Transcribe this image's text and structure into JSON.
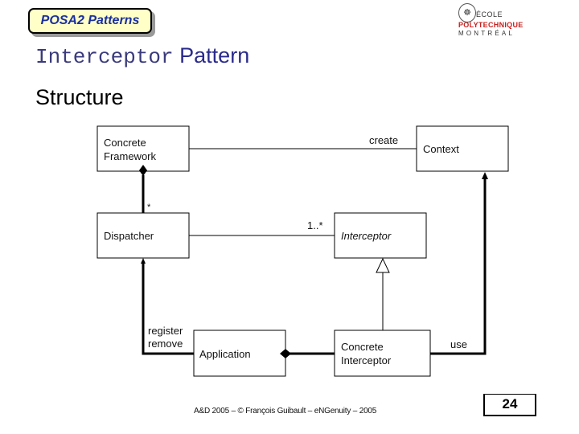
{
  "header": {
    "badge_label": "POSA2 Patterns",
    "logo": {
      "crest_icon": "university-crest-icon",
      "line1": "ÉCOLE",
      "line2": "POLYTECHNIQUE",
      "line3": "MONTRÉAL"
    }
  },
  "slide": {
    "title_mono": "Interceptor",
    "title_rest": "Pattern",
    "subtitle": "Structure"
  },
  "diagram": {
    "classes": {
      "concrete_framework": [
        "Concrete",
        "Framework"
      ],
      "context": "Context",
      "dispatcher": "Dispatcher",
      "interceptor": "Interceptor",
      "application": "Application",
      "concrete_interceptor": [
        "Concrete",
        "Interceptor"
      ]
    },
    "relations": {
      "create": "create",
      "framework_dispatcher_multiplicity": "*",
      "dispatcher_interceptor_multiplicity": "1..*",
      "register_remove": [
        "register",
        "remove"
      ],
      "use": "use"
    }
  },
  "footer": {
    "text": "A&D 2005 – © François Guibault – eNGenuity – 2005",
    "page_number": "24"
  }
}
